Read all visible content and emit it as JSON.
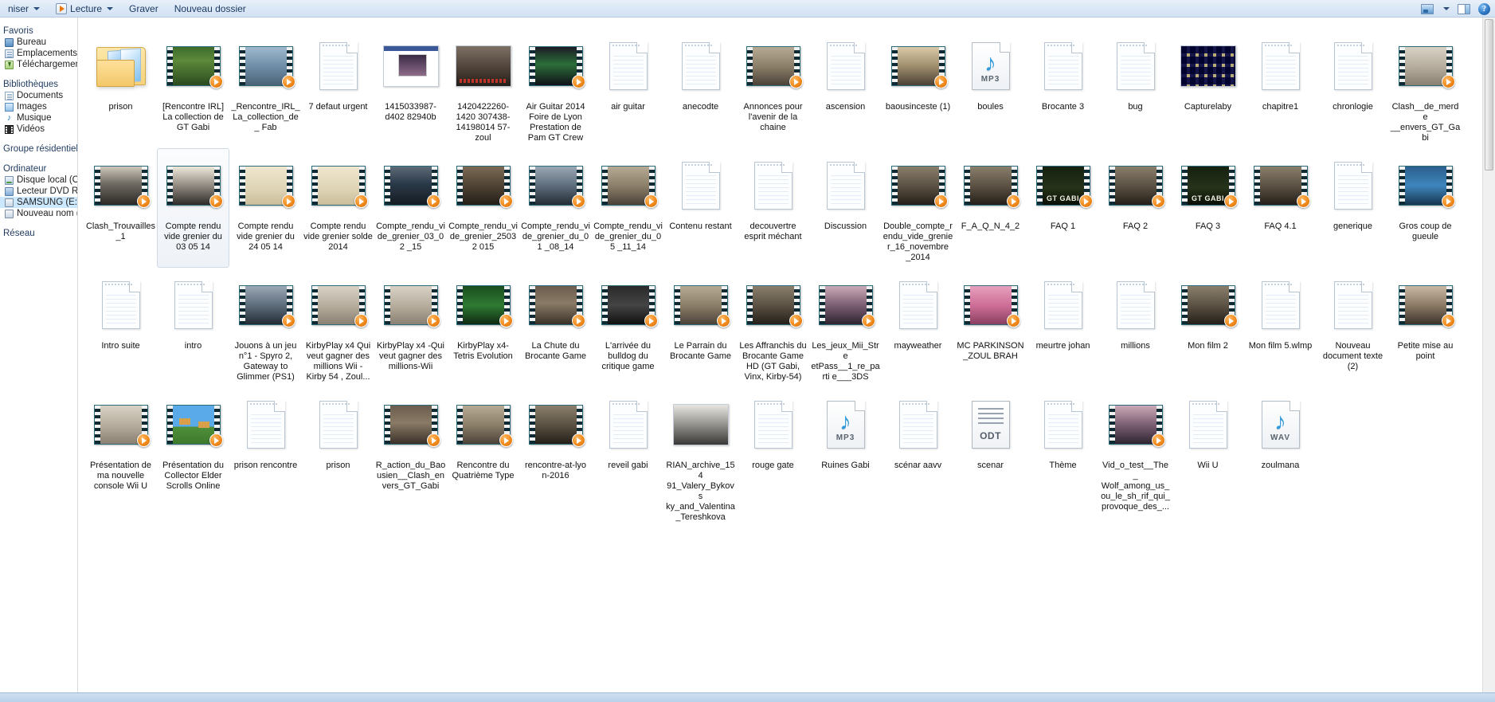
{
  "toolbar": {
    "organize_label": "niser",
    "play_label": "Lecture",
    "burn_label": "Graver",
    "new_folder_label": "Nouveau dossier",
    "view_icon": "view-layout-icon",
    "view_caret_icon": "chevron-down-icon",
    "preview_pane_icon": "preview-pane-icon",
    "help_icon": "help-icon",
    "help_glyph": "?"
  },
  "sidebar": {
    "groups": [
      {
        "title": "Favoris",
        "items": [
          {
            "label": "Bureau",
            "icon": "desktop-icon",
            "selected": false
          },
          {
            "label": "Emplacements récen",
            "icon": "recent-places-icon",
            "selected": false
          },
          {
            "label": "Téléchargements",
            "icon": "downloads-icon",
            "selected": false
          }
        ]
      },
      {
        "title": "Bibliothèques",
        "items": [
          {
            "label": "Documents",
            "icon": "documents-icon",
            "selected": false
          },
          {
            "label": "Images",
            "icon": "pictures-icon",
            "selected": false
          },
          {
            "label": "Musique",
            "icon": "music-icon",
            "selected": false
          },
          {
            "label": "Vidéos",
            "icon": "videos-icon",
            "selected": false
          }
        ]
      },
      {
        "title": "Groupe résidentiel",
        "items": []
      },
      {
        "title": "Ordinateur",
        "items": [
          {
            "label": "Disque local (C:)",
            "icon": "hard-disk-icon",
            "selected": false
          },
          {
            "label": "Lecteur DVD RW (D:",
            "icon": "dvd-drive-icon",
            "selected": false
          },
          {
            "label": "SAMSUNG (E:)",
            "icon": "usb-drive-icon",
            "selected": true
          },
          {
            "label": "Nouveau nom (X:)",
            "icon": "usb-drive-icon",
            "selected": false
          }
        ]
      },
      {
        "title": "Réseau",
        "items": []
      }
    ]
  },
  "files": [
    {
      "name": "prison",
      "type": "folder",
      "thumb": "folder"
    },
    {
      "name": "[Rencontre IRL] La collection de GT Gabi",
      "type": "video",
      "thumb": "ph-grass"
    },
    {
      "name": "_Rencontre_IRL_ La_collection_de_ Fab",
      "type": "video",
      "thumb": "ph-sky"
    },
    {
      "name": "7 defaut urgent",
      "type": "file",
      "thumb": "file"
    },
    {
      "name": "1415033987-d402 82940b",
      "type": "image",
      "thumb": "ph-fb"
    },
    {
      "name": "1420422260-1420 307438-14198014 57-zoul",
      "type": "image",
      "thumb": "ph-poster"
    },
    {
      "name": "Air Guitar 2014 Foire de Lyon Prestation de Pam GT Crew",
      "type": "video",
      "thumb": "ph-stage"
    },
    {
      "name": "air guitar",
      "type": "file",
      "thumb": "file"
    },
    {
      "name": "anecodte",
      "type": "file",
      "thumb": "file"
    },
    {
      "name": "Annonces pour l'avenir de la chaine",
      "type": "video",
      "thumb": "ph-indoor"
    },
    {
      "name": "ascension",
      "type": "file",
      "thumb": "file"
    },
    {
      "name": "baousinceste (1)",
      "type": "video",
      "thumb": "ph-kitchen"
    },
    {
      "name": "boules",
      "type": "audio",
      "thumb": "MP3"
    },
    {
      "name": "Brocante 3",
      "type": "file",
      "thumb": "file"
    },
    {
      "name": "bug",
      "type": "file",
      "thumb": "file"
    },
    {
      "name": "Capturelaby",
      "type": "image",
      "thumb": "ph-maze"
    },
    {
      "name": "chapitre1",
      "type": "file",
      "thumb": "file"
    },
    {
      "name": "chronlogie",
      "type": "file",
      "thumb": "file"
    },
    {
      "name": "Clash__de_merde __envers_GT_Gabi",
      "type": "video",
      "thumb": "ph-wall"
    },
    {
      "name": "Clash_Trouvailles _1",
      "type": "video",
      "thumb": "ph-doorway"
    },
    {
      "name": "Compte rendu vide grenier du 03 05 14",
      "type": "video",
      "thumb": "ph-bw",
      "selected": true
    },
    {
      "name": "Compte rendu vide grenier du 24 05 14",
      "type": "video",
      "thumb": "ph-paper"
    },
    {
      "name": "Compte rendu vide grenier solde 2014",
      "type": "video",
      "thumb": "ph-paper"
    },
    {
      "name": "Compte_rendu_vi de_grenier_03_02 _15",
      "type": "video",
      "thumb": "ph-tv"
    },
    {
      "name": "Compte_rendu_vi de_grenier_25032 015",
      "type": "video",
      "thumb": "ph-shelf"
    },
    {
      "name": "Compte_rendu_vi de_grenier_du_01 _08_14",
      "type": "video",
      "thumb": "ph-desk"
    },
    {
      "name": "Compte_rendu_vi de_grenier_du_05 _11_14",
      "type": "video",
      "thumb": "ph-indoor"
    },
    {
      "name": "Contenu restant",
      "type": "file",
      "thumb": "file"
    },
    {
      "name": "decouvertre esprit méchant",
      "type": "file",
      "thumb": "file"
    },
    {
      "name": "Discussion",
      "type": "file",
      "thumb": "file"
    },
    {
      "name": "Double_compte_r endu_vide_grenie r_16_novembre _2014",
      "type": "video",
      "thumb": "ph-group"
    },
    {
      "name": "F_A_Q_N_4_2",
      "type": "video",
      "thumb": "ph-group"
    },
    {
      "name": "FAQ 1",
      "type": "video",
      "thumb": "ph-gtgabi"
    },
    {
      "name": "FAQ 2",
      "type": "video",
      "thumb": "ph-group"
    },
    {
      "name": "FAQ 3",
      "type": "video",
      "thumb": "ph-gtgabi"
    },
    {
      "name": "FAQ 4.1",
      "type": "video",
      "thumb": "ph-group"
    },
    {
      "name": "generique",
      "type": "file",
      "thumb": "file"
    },
    {
      "name": "Gros coup de gueule",
      "type": "video",
      "thumb": "ph-blue"
    },
    {
      "name": "Intro suite",
      "type": "file",
      "thumb": "file"
    },
    {
      "name": "intro",
      "type": "file",
      "thumb": "file"
    },
    {
      "name": "Jouons à un jeu n°1 - Spyro 2, Gateway to Glimmer (PS1)",
      "type": "video",
      "thumb": "ph-desk"
    },
    {
      "name": "KirbyPlay x4 Qui veut gagner des millions Wii - Kirby 54 , Zoul...",
      "type": "video",
      "thumb": "ph-wall"
    },
    {
      "name": "KirbyPlay x4 -Qui veut gagner des millions-Wii",
      "type": "video",
      "thumb": "ph-wall"
    },
    {
      "name": "KirbyPlay x4-Tetris Evolution",
      "type": "video",
      "thumb": "ph-green"
    },
    {
      "name": "La Chute du Brocante Game",
      "type": "video",
      "thumb": "ph-room"
    },
    {
      "name": "L'arrivée du bulldog du critique game",
      "type": "video",
      "thumb": "ph-dark"
    },
    {
      "name": "Le Parrain du Brocante Game",
      "type": "video",
      "thumb": "ph-indoor"
    },
    {
      "name": "Les Affranchis du Brocante Game HD (GT Gabi, Vinx, Kirby-54)",
      "type": "video",
      "thumb": "ph-group"
    },
    {
      "name": "Les_jeux_Mii_Stre etPass__1_re_parti e___3DS",
      "type": "video",
      "thumb": "ph-cam"
    },
    {
      "name": "mayweather",
      "type": "file",
      "thumb": "file"
    },
    {
      "name": "MC PARKINSON _ZOUL BRAH",
      "type": "video",
      "thumb": "ph-pink"
    },
    {
      "name": "meurtre johan",
      "type": "file",
      "thumb": "file"
    },
    {
      "name": "millions",
      "type": "file",
      "thumb": "file"
    },
    {
      "name": "Mon film 2",
      "type": "video",
      "thumb": "ph-group"
    },
    {
      "name": "Mon film 5.wlmp",
      "type": "file",
      "thumb": "file-wlmp"
    },
    {
      "name": "Nouveau document texte (2)",
      "type": "file",
      "thumb": "file"
    },
    {
      "name": "Petite mise au point",
      "type": "video",
      "thumb": "ph-webcam"
    },
    {
      "name": "Présentation de ma nouvelle console Wii U",
      "type": "video",
      "thumb": "ph-wall"
    },
    {
      "name": "Présentation du Collector Elder Scrolls Online",
      "type": "video",
      "thumb": "ph-mario"
    },
    {
      "name": "prison rencontre",
      "type": "file",
      "thumb": "file"
    },
    {
      "name": "prison",
      "type": "file",
      "thumb": "file"
    },
    {
      "name": "R_action_du_Bao usien__Clash_en vers_GT_Gabi",
      "type": "video",
      "thumb": "ph-room"
    },
    {
      "name": "Rencontre du Quatrième Type",
      "type": "video",
      "thumb": "ph-indoor"
    },
    {
      "name": "rencontre-at-lyo n-2016",
      "type": "video",
      "thumb": "ph-group"
    },
    {
      "name": "reveil gabi",
      "type": "file",
      "thumb": "file"
    },
    {
      "name": "RIAN_archive_154 91_Valery_Bykovs ky_and_Valentina _Tereshkova",
      "type": "image",
      "thumb": "ph-soviet"
    },
    {
      "name": "rouge gate",
      "type": "file",
      "thumb": "file"
    },
    {
      "name": "Ruines Gabi",
      "type": "audio",
      "thumb": "MP3"
    },
    {
      "name": "scénar aavv",
      "type": "file",
      "thumb": "file"
    },
    {
      "name": "scenar",
      "type": "odt",
      "thumb": "ODT"
    },
    {
      "name": "Thème",
      "type": "file",
      "thumb": "file"
    },
    {
      "name": "Vid_o_test__The_ Wolf_among_us_ ou_le_sh_rif_qui_ provoque_des_...",
      "type": "video",
      "thumb": "ph-cam"
    },
    {
      "name": "Wii U",
      "type": "file",
      "thumb": "file"
    },
    {
      "name": "zoulmana",
      "type": "audio",
      "thumb": "WAV"
    }
  ]
}
